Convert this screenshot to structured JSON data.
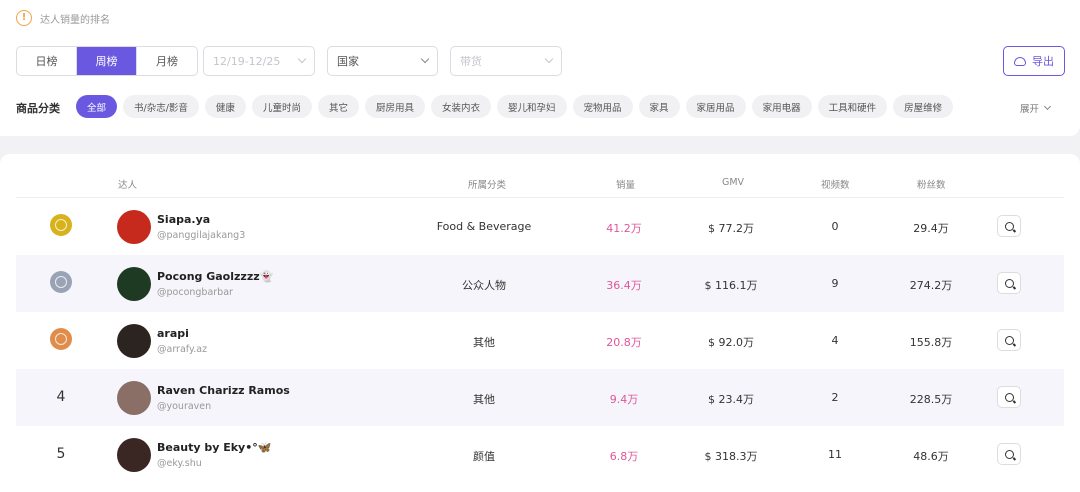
{
  "notice": {
    "icon": "info-icon",
    "text": "达人销量的排名"
  },
  "period_tabs": [
    {
      "label": "日榜",
      "active": false
    },
    {
      "label": "周榜",
      "active": true
    },
    {
      "label": "月榜",
      "active": false
    }
  ],
  "filters": {
    "date_range": "12/19-12/25",
    "country": "国家",
    "live_type": "带货"
  },
  "export_label": "导出",
  "category_label": "商品分类",
  "categories": [
    {
      "label": "全部",
      "active": true
    },
    {
      "label": "书/杂志/影音"
    },
    {
      "label": "健康"
    },
    {
      "label": "儿童时尚"
    },
    {
      "label": "其它"
    },
    {
      "label": "厨房用具"
    },
    {
      "label": "女装内衣"
    },
    {
      "label": "婴儿和孕妇"
    },
    {
      "label": "宠物用品"
    },
    {
      "label": "家具"
    },
    {
      "label": "家居用品"
    },
    {
      "label": "家用电器"
    },
    {
      "label": "工具和硬件"
    },
    {
      "label": "房屋维修"
    }
  ],
  "expand_label": "展开",
  "table": {
    "headers": {
      "influencer": "达人",
      "category": "所属分类",
      "sales": "销量",
      "gmv": "GMV",
      "videos": "视频数",
      "fans": "粉丝数"
    },
    "rows": [
      {
        "rank": "1",
        "medal": "gold",
        "name": "Siapa.ya",
        "handle": "@panggilajakang3",
        "category": "Food & Beverage",
        "sales": "41.2万",
        "gmv": "$ 77.2万",
        "videos": "0",
        "fans": "29.4万",
        "avatar": "#c62a1c"
      },
      {
        "rank": "2",
        "medal": "silver",
        "name": "Pocong Gaolzzzz👻",
        "handle": "@pocongbarbar",
        "category": "公众人物",
        "sales": "36.4万",
        "gmv": "$ 116.1万",
        "videos": "9",
        "fans": "274.2万",
        "avatar": "#1f3a22"
      },
      {
        "rank": "3",
        "medal": "bronze",
        "name": "arapi",
        "handle": "@arrafy.az",
        "category": "其他",
        "sales": "20.8万",
        "gmv": "$ 92.0万",
        "videos": "4",
        "fans": "155.8万",
        "avatar": "#2b2420"
      },
      {
        "rank": "4",
        "medal": "",
        "name": "Raven Charizz Ramos",
        "handle": "@youraven",
        "category": "其他",
        "sales": "9.4万",
        "gmv": "$ 23.4万",
        "videos": "2",
        "fans": "228.5万",
        "avatar": "#8a6f66"
      },
      {
        "rank": "5",
        "medal": "",
        "name": "Beauty by Eky•°🦋",
        "handle": "@eky.shu",
        "category": "颜值",
        "sales": "6.8万",
        "gmv": "$ 318.3万",
        "videos": "11",
        "fans": "48.6万",
        "avatar": "#3a2622"
      }
    ]
  },
  "colors": {
    "accent": "#6a59e0",
    "sales": "#e0559a",
    "gold": "#d7b21b",
    "silver": "#9aa3b5",
    "bronze": "#e08d4c"
  }
}
